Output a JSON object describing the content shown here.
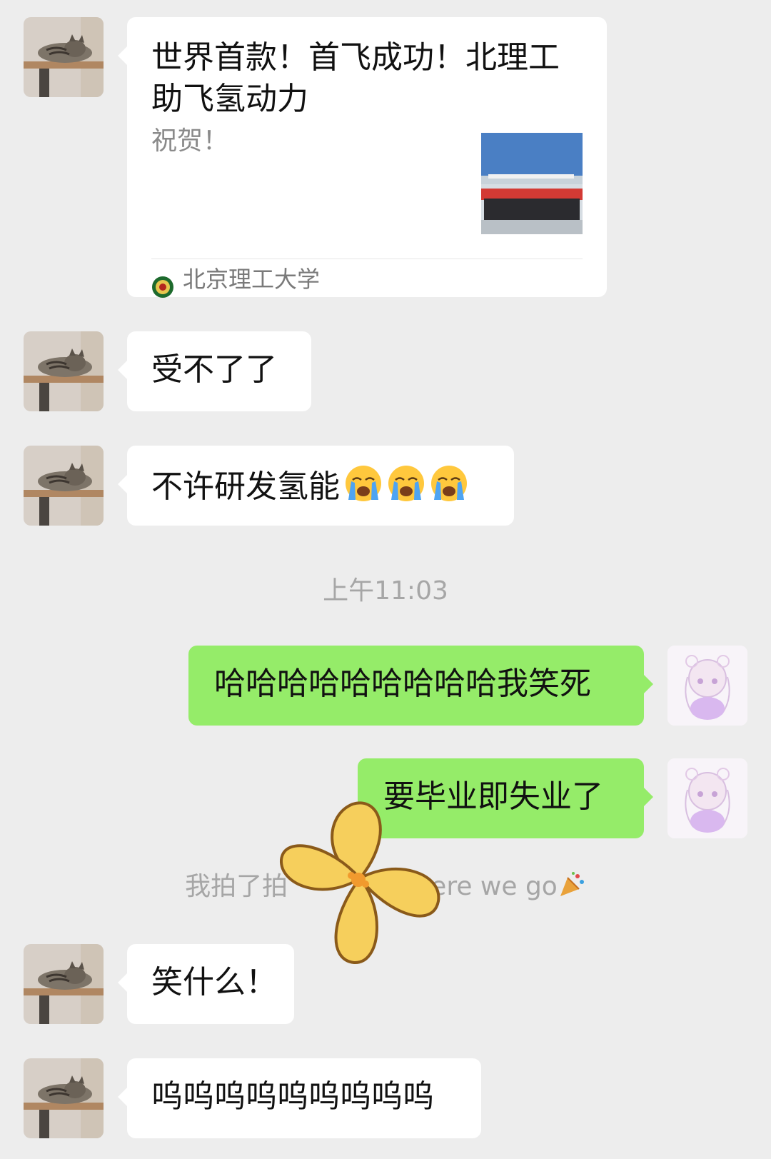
{
  "chat": {
    "card": {
      "title": "世界首款！首飞成功！北理工助飞氢动力",
      "description": "祝贺！",
      "source": "北京理工大学"
    },
    "msg1": "受不了了",
    "msg2": "不许研发氢能",
    "msg2_emoji": [
      "loudly-crying-face",
      "loudly-crying-face",
      "loudly-crying-face"
    ],
    "timestamp": "上午11:03",
    "msg3": "哈哈哈哈哈哈哈哈哈我笑死",
    "msg4": "要毕业即失业了",
    "pat_text_left": "我拍了拍",
    "pat_text_right": "ere we go",
    "msg5": "笑什么！",
    "msg6": "呜呜呜呜呜呜呜呜呜"
  },
  "colors": {
    "background": "#ededed",
    "incoming_bubble": "#ffffff",
    "outgoing_bubble": "#95ec69",
    "system_text": "#a6a6a6"
  }
}
